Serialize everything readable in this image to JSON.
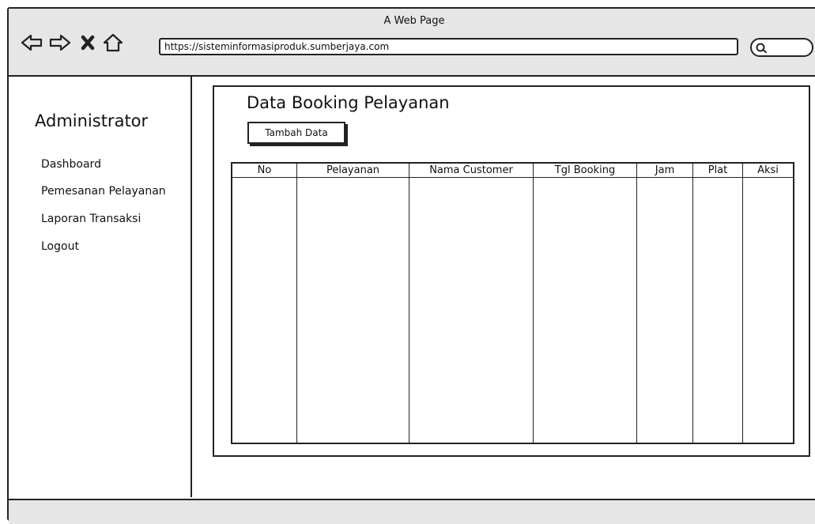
{
  "window": {
    "title": "A Web Page"
  },
  "browser": {
    "url": "https://sisteminformasiproduk.sumberjaya.com",
    "nav_icons": [
      "back-icon",
      "forward-icon",
      "close-icon",
      "home-icon"
    ],
    "search_icon": "search-icon"
  },
  "sidebar": {
    "heading": "Administrator",
    "items": [
      {
        "label": "Dashboard"
      },
      {
        "label": "Pemesanan Pelayanan"
      },
      {
        "label": "Laporan Transaksi"
      },
      {
        "label": "Logout"
      }
    ]
  },
  "main": {
    "title": "Data Booking Pelayanan",
    "add_button_label": "Tambah Data",
    "table": {
      "columns": [
        "No",
        "Pelayanan",
        "Nama Customer",
        "Tgl Booking",
        "Jam",
        "Plat",
        "Aksi"
      ],
      "rows": []
    }
  }
}
